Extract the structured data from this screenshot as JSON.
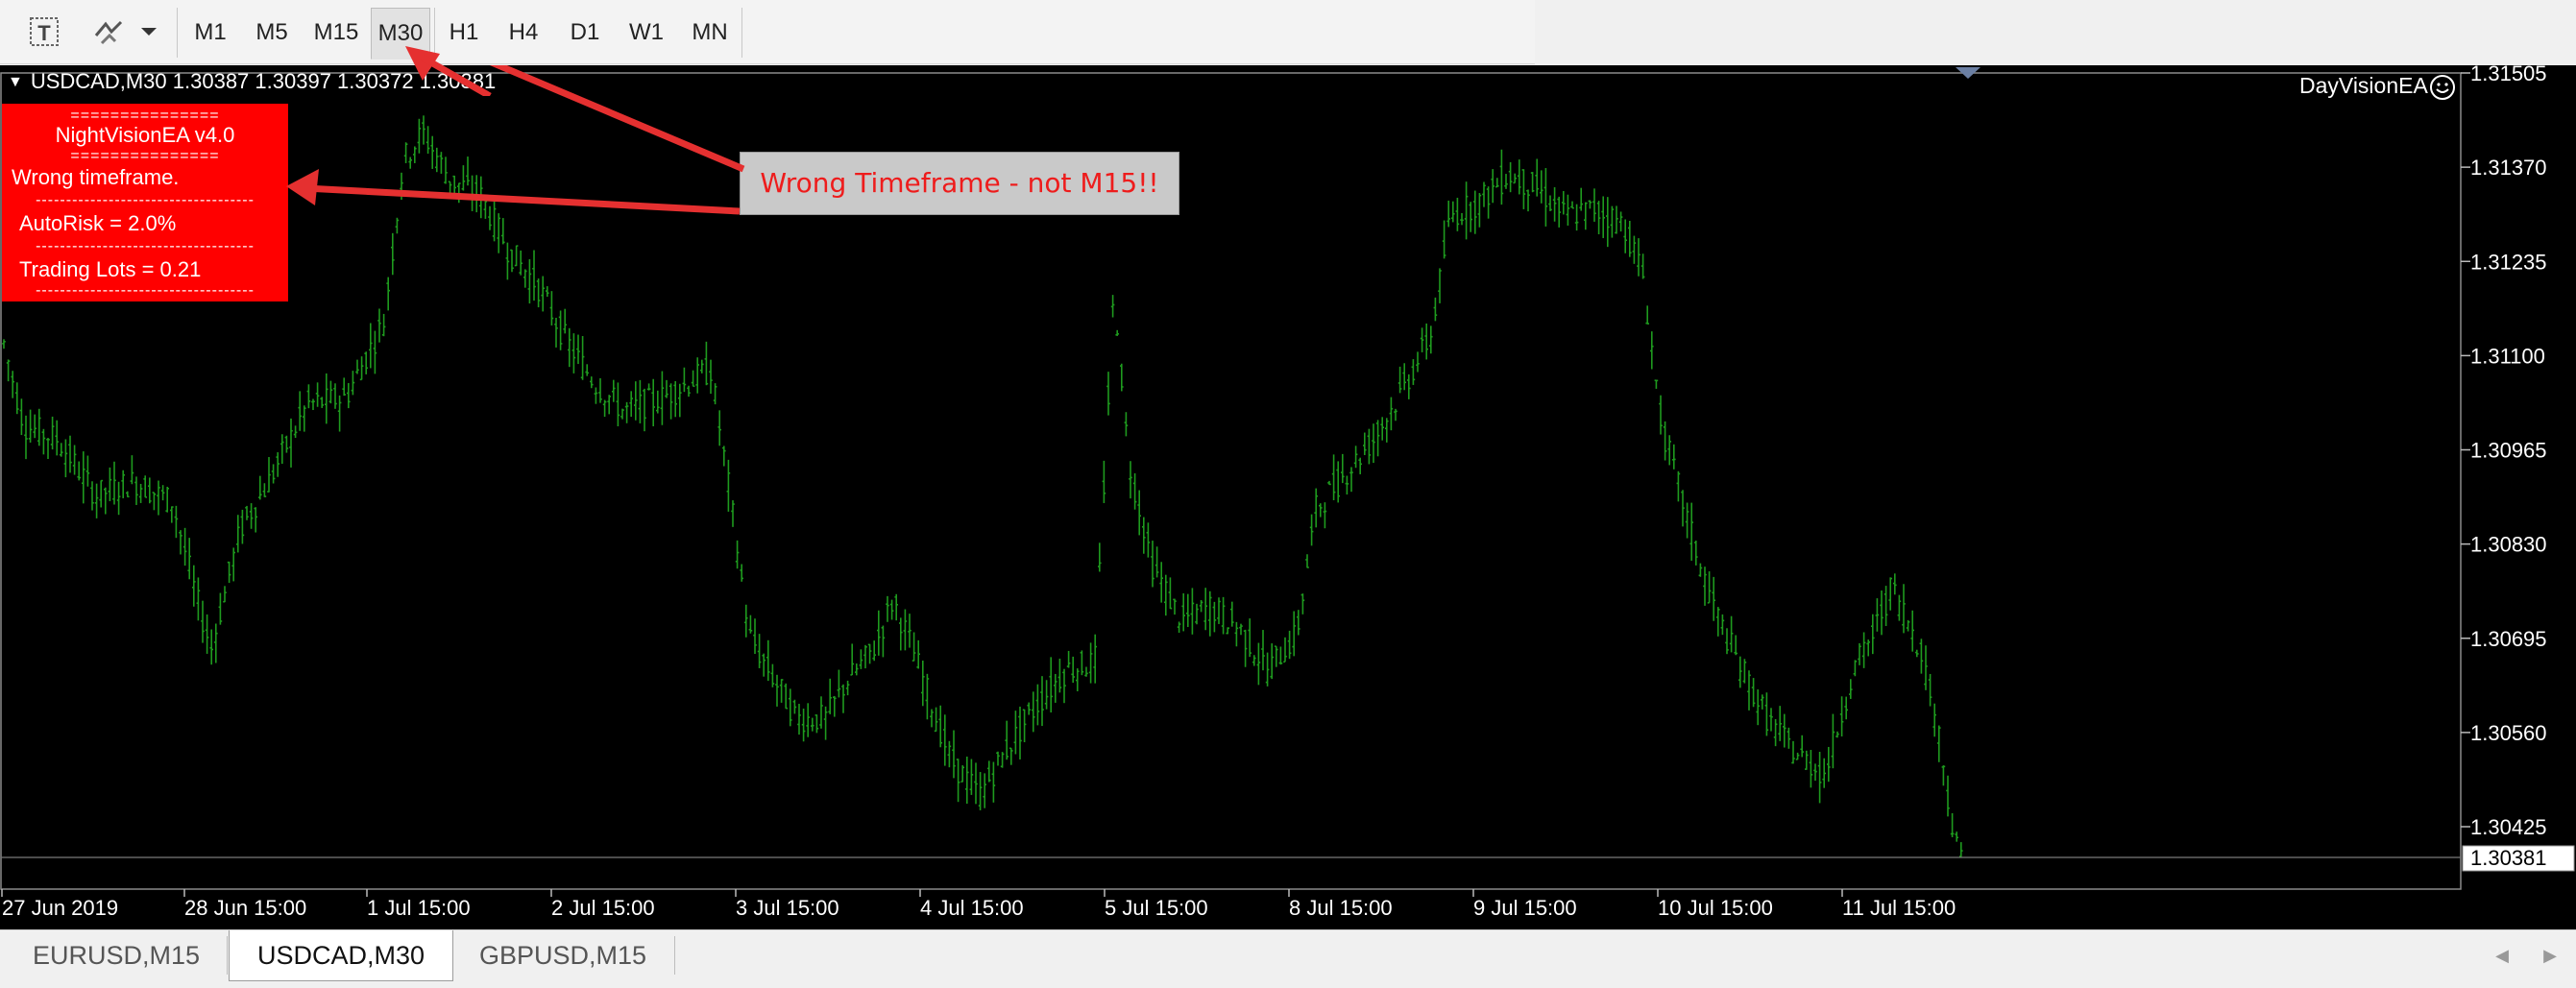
{
  "toolbar": {
    "tool_icons": [
      "text-tool-icon",
      "objects-tool-icon",
      "dropdown-arrow-icon"
    ],
    "timeframes": [
      "M1",
      "M5",
      "M15",
      "M30",
      "H1",
      "H4",
      "D1",
      "W1",
      "MN"
    ],
    "active_timeframe": "M30"
  },
  "chart": {
    "symbol_header": "USDCAD,M30  1.30387 1.30397 1.30372 1.30381",
    "ea_label": "DayVisionEA",
    "panel": {
      "separator": "===============",
      "title": "NightVisionEA v4.0",
      "separator2": "===============",
      "message": "Wrong timeframe.",
      "dash": "------------------------------------",
      "autorisk": "AutoRisk = 2.0%",
      "dash2": "------------------------------------",
      "lots": "Trading Lots = 0.21",
      "dash3": "------------------------------------"
    },
    "callout": "Wrong Timeframe - not M15!!",
    "colors": {
      "candles": "#1e9a1e",
      "background": "#000000",
      "panel": "#ff0000",
      "arrow": "#e03030"
    }
  },
  "chart_data": {
    "type": "candlestick",
    "symbol": "USDCAD",
    "timeframe": "M30",
    "y_ticks": [
      "1.31505",
      "1.31370",
      "1.31235",
      "1.31100",
      "1.30965",
      "1.30830",
      "1.30695",
      "1.30560",
      "1.30425"
    ],
    "current_price": "1.30381",
    "x_ticks": [
      "27 Jun 2019",
      "28 Jun 15:00",
      "1 Jul 15:00",
      "2 Jul 15:00",
      "3 Jul 15:00",
      "4 Jul 15:00",
      "5 Jul 15:00",
      "8 Jul 15:00",
      "9 Jul 15:00",
      "10 Jul 15:00",
      "11 Jul 15:00"
    ],
    "ylim": [
      1.3038,
      1.3152
    ],
    "price_path": [
      [
        0,
        1.3114
      ],
      [
        25,
        1.31
      ],
      [
        60,
        1.3098
      ],
      [
        100,
        1.309
      ],
      [
        140,
        1.3092
      ],
      [
        180,
        1.3089
      ],
      [
        205,
        1.3075
      ],
      [
        220,
        1.3068
      ],
      [
        250,
        1.3085
      ],
      [
        280,
        1.3092
      ],
      [
        320,
        1.3103
      ],
      [
        360,
        1.3104
      ],
      [
        400,
        1.3115
      ],
      [
        420,
        1.3138
      ],
      [
        440,
        1.3142
      ],
      [
        470,
        1.3135
      ],
      [
        500,
        1.3133
      ],
      [
        530,
        1.3125
      ],
      [
        560,
        1.312
      ],
      [
        590,
        1.3112
      ],
      [
        620,
        1.3106
      ],
      [
        650,
        1.3102
      ],
      [
        690,
        1.3104
      ],
      [
        740,
        1.3108
      ],
      [
        760,
        1.309
      ],
      [
        780,
        1.307
      ],
      [
        800,
        1.3065
      ],
      [
        830,
        1.3058
      ],
      [
        860,
        1.3058
      ],
      [
        880,
        1.3063
      ],
      [
        910,
        1.3068
      ],
      [
        930,
        1.3075
      ],
      [
        950,
        1.3068
      ],
      [
        970,
        1.306
      ],
      [
        990,
        1.3052
      ],
      [
        1020,
        1.3047
      ],
      [
        1050,
        1.3054
      ],
      [
        1080,
        1.306
      ],
      [
        1110,
        1.3065
      ],
      [
        1140,
        1.3066
      ],
      [
        1160,
        1.312
      ],
      [
        1175,
        1.3095
      ],
      [
        1200,
        1.308
      ],
      [
        1230,
        1.3072
      ],
      [
        1260,
        1.3074
      ],
      [
        1290,
        1.3071
      ],
      [
        1320,
        1.3065
      ],
      [
        1350,
        1.307
      ],
      [
        1370,
        1.3088
      ],
      [
        1400,
        1.3093
      ],
      [
        1430,
        1.3098
      ],
      [
        1460,
        1.3105
      ],
      [
        1490,
        1.3113
      ],
      [
        1510,
        1.313
      ],
      [
        1540,
        1.3132
      ],
      [
        1570,
        1.3136
      ],
      [
        1600,
        1.3134
      ],
      [
        1630,
        1.313
      ],
      [
        1660,
        1.3131
      ],
      [
        1690,
        1.3129
      ],
      [
        1710,
        1.3122
      ],
      [
        1730,
        1.31
      ],
      [
        1750,
        1.309
      ],
      [
        1770,
        1.308
      ],
      [
        1790,
        1.3072
      ],
      [
        1810,
        1.3066
      ],
      [
        1840,
        1.3058
      ],
      [
        1870,
        1.3053
      ],
      [
        1900,
        1.305
      ],
      [
        1930,
        1.3065
      ],
      [
        1950,
        1.307
      ],
      [
        1970,
        1.3077
      ],
      [
        2000,
        1.3068
      ],
      [
        2020,
        1.3055
      ],
      [
        2035,
        1.304
      ],
      [
        2045,
        1.3038
      ]
    ]
  },
  "tabs": [
    {
      "label": "EURUSD,M15",
      "active": false
    },
    {
      "label": "USDCAD,M30",
      "active": true
    },
    {
      "label": "GBPUSD,M15",
      "active": false
    }
  ],
  "scroll_icons": [
    "scroll-left-icon",
    "scroll-right-icon"
  ]
}
